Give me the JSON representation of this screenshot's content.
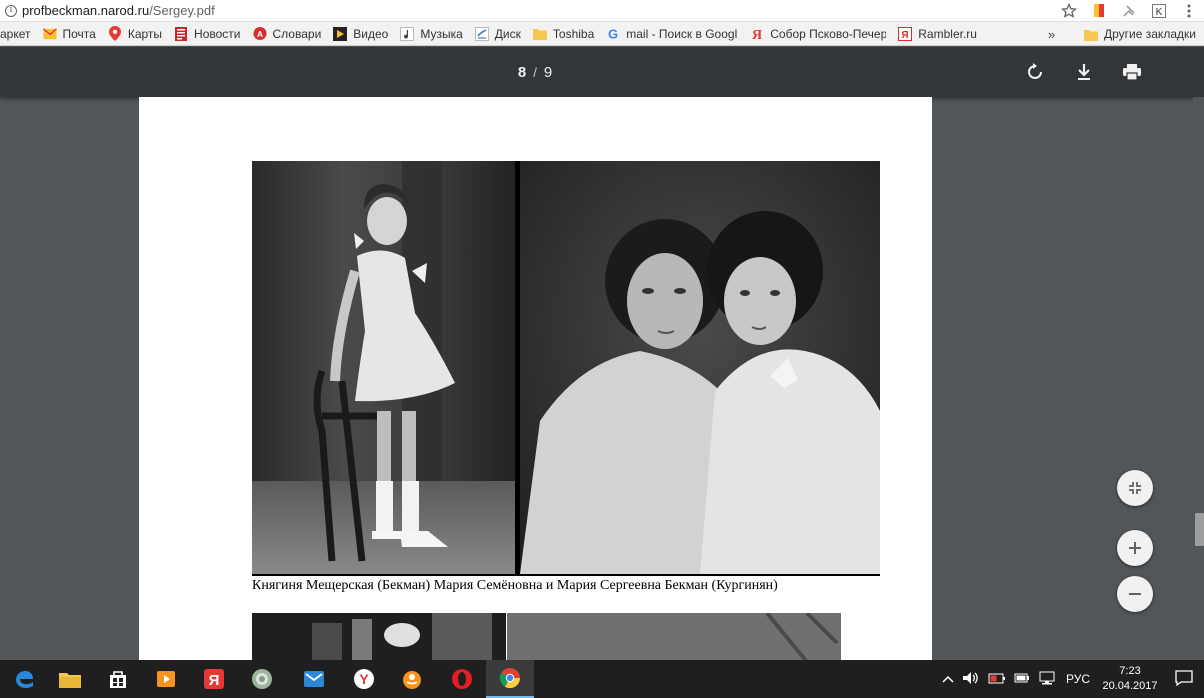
{
  "address": {
    "url_host": "profbeckman.narod.ru",
    "url_path": "/Sergey.pdf"
  },
  "bookmarks": [
    {
      "label": "аркет",
      "icon": "market-icon",
      "color": "#e53935"
    },
    {
      "label": "Почта",
      "icon": "mail-envelope-icon",
      "color": "#fbc02d"
    },
    {
      "label": "Карты",
      "icon": "map-pin-icon",
      "color": "#e53935"
    },
    {
      "label": "Новости",
      "icon": "news-icon",
      "color": "#c62828"
    },
    {
      "label": "Словари",
      "icon": "dictionary-icon",
      "color": "#d32f2f"
    },
    {
      "label": "Видео",
      "icon": "video-icon",
      "color": "#222222"
    },
    {
      "label": "Музыка",
      "icon": "music-icon",
      "color": "#555555"
    },
    {
      "label": "Диск",
      "icon": "disk-icon",
      "color": "#4a76a8"
    },
    {
      "label": "Toshiba",
      "icon": "folder-icon",
      "color": "#f6c94e"
    },
    {
      "label": "mail - Поиск в Googl",
      "icon": "google-icon",
      "color": "#4285f4"
    },
    {
      "label": "Собор Псково-Печер",
      "icon": "yandex-icon",
      "color": "#e53935"
    },
    {
      "label": "Rambler.ru",
      "icon": "rambler-icon",
      "color": "#d32f2f"
    }
  ],
  "bookmarks_more": "»",
  "bookmarks_other": "Другие закладки",
  "pdf": {
    "current_page": "8",
    "separator": "/",
    "total_pages": "9"
  },
  "caption": "Княгиня Мещерская (Бекман) Мария Семёновна  и Мария Сергеевна Бекман (Кургинян)",
  "taskbar": {
    "language": "РУС",
    "time": "7:23",
    "date": "20.04.2017"
  }
}
